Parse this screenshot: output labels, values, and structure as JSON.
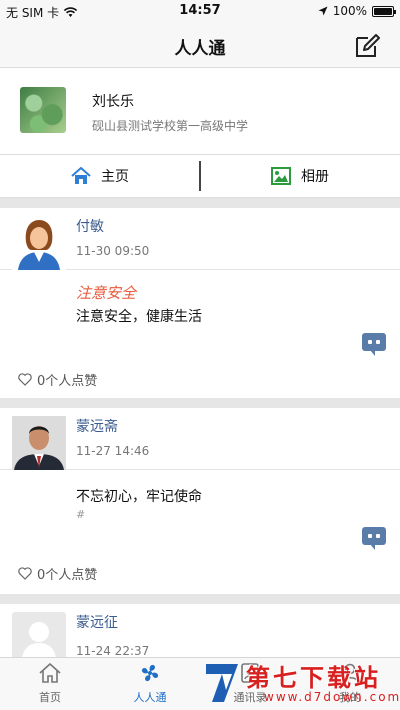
{
  "status_bar": {
    "carrier": "无 SIM 卡",
    "time": "14:57",
    "battery": "100%"
  },
  "nav": {
    "title": "人人通"
  },
  "profile": {
    "name": "刘长乐",
    "school": "砚山县测试学校第一高级中学"
  },
  "tabs": [
    {
      "label": "主页"
    },
    {
      "label": "相册"
    }
  ],
  "posts": [
    {
      "author": "付敏",
      "time": "11-30 09:50",
      "title": "注意安全",
      "text": "注意安全，健康生活",
      "hash": "",
      "likes": "0个人点赞"
    },
    {
      "author": "蒙远斋",
      "time": "11-27 14:46",
      "title": "",
      "text": "不忘初心，牢记使命",
      "hash": "#",
      "likes": "0个人点赞"
    },
    {
      "author": "蒙远征",
      "time": "11-24 22:37"
    }
  ],
  "tabbar": [
    {
      "label": "首页",
      "icon": "home-icon"
    },
    {
      "label": "人人通",
      "icon": "fan-icon"
    },
    {
      "label": "通讯录",
      "icon": "contacts-icon"
    },
    {
      "label": "我的",
      "icon": "person-icon"
    }
  ],
  "watermark": {
    "title": "第七下载站",
    "url": "www.d7down.com"
  },
  "colors": {
    "accent": "#1f6fc5",
    "link": "#3b5c8f",
    "highlight": "#e85a3a",
    "comment": "#5a7ca8"
  }
}
